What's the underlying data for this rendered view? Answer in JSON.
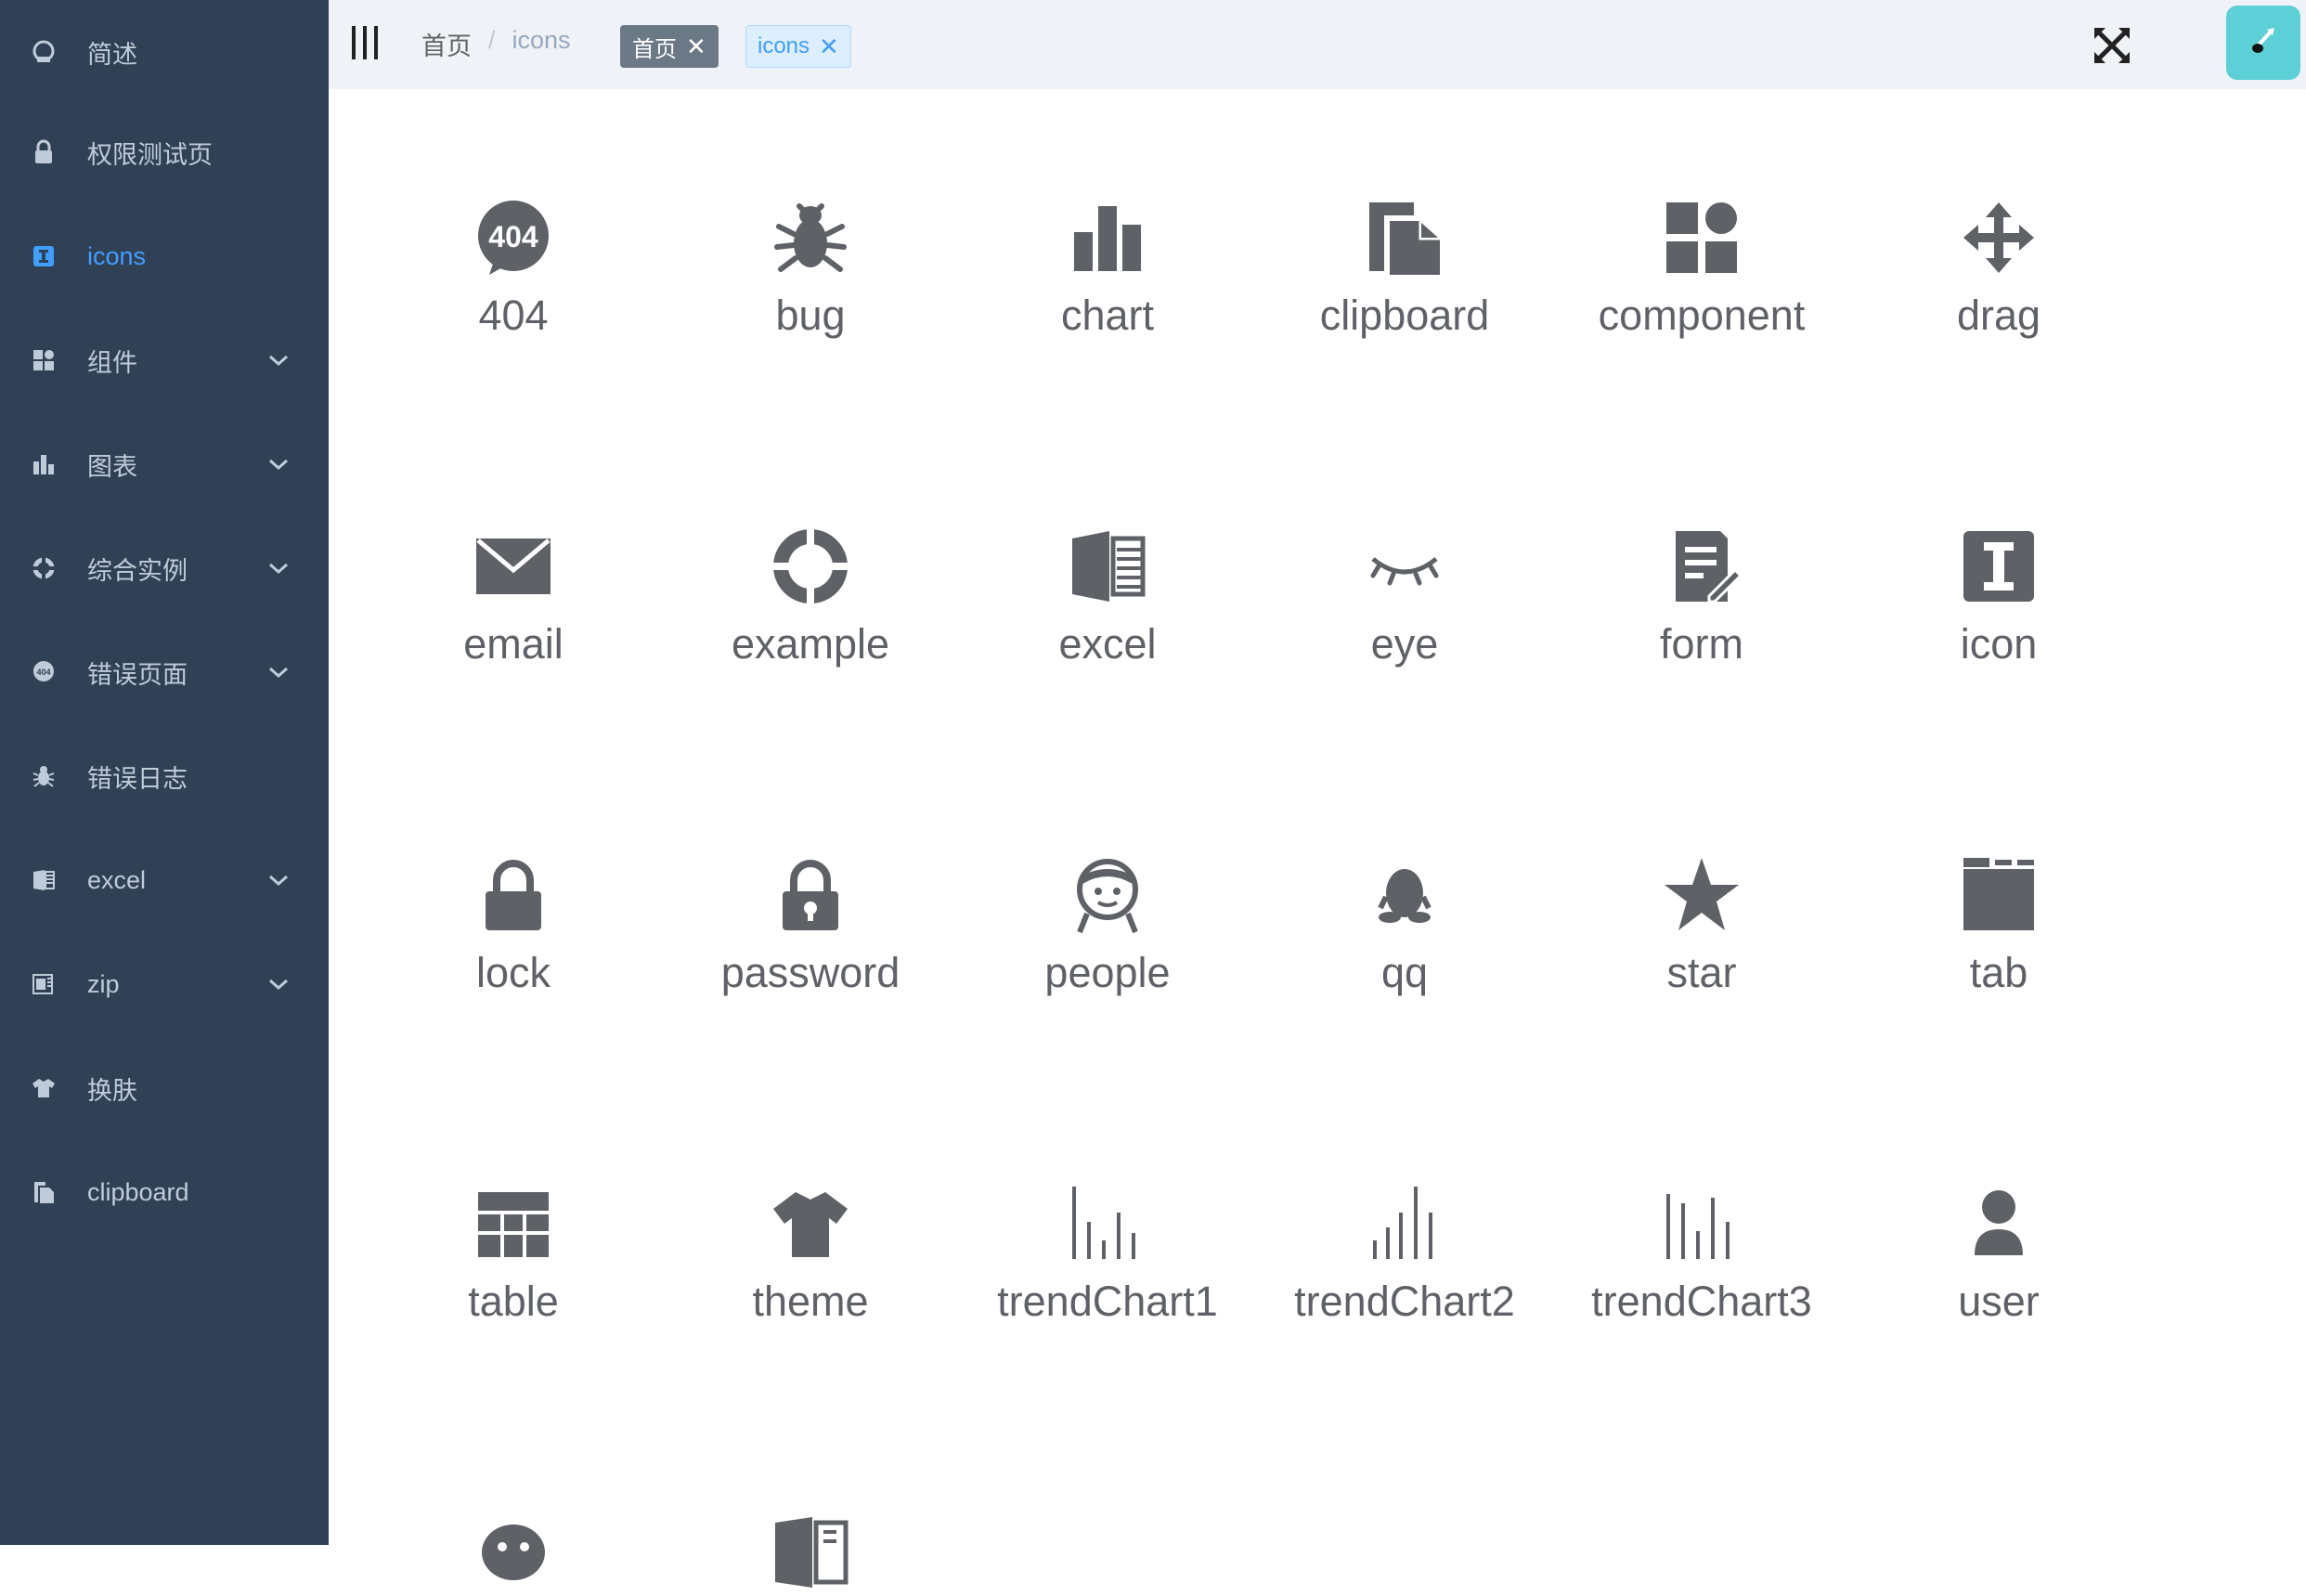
{
  "colors": {
    "sidebar_bg": "#304156",
    "sidebar_text": "#bfcbd9",
    "active": "#409eff",
    "navbar_bg": "#eff2f6",
    "icon": "#5e6166",
    "avatar_bg": "#5dcfd6"
  },
  "sidebar": {
    "items": [
      {
        "label": "简述",
        "icon": "dashboard-icon"
      },
      {
        "label": "权限测试页",
        "icon": "lock-icon"
      },
      {
        "label": "icons",
        "icon": "icon-icon",
        "active": true
      },
      {
        "label": "组件",
        "icon": "component-icon",
        "expandable": true
      },
      {
        "label": "图表",
        "icon": "chart-icon",
        "expandable": true
      },
      {
        "label": "综合实例",
        "icon": "example-icon",
        "expandable": true
      },
      {
        "label": "错误页面",
        "icon": "404-icon",
        "expandable": true
      },
      {
        "label": "错误日志",
        "icon": "bug-icon"
      },
      {
        "label": "excel",
        "icon": "excel-icon",
        "expandable": true
      },
      {
        "label": "zip",
        "icon": "zip-icon",
        "expandable": true
      },
      {
        "label": "换肤",
        "icon": "theme-icon"
      },
      {
        "label": "clipboard",
        "icon": "clipboard-icon"
      }
    ]
  },
  "navbar": {
    "breadcrumb": {
      "home": "首页",
      "separator": "/",
      "current": "icons"
    },
    "tags": [
      {
        "label": "首页",
        "close": "✕"
      },
      {
        "label": "icons",
        "close": "✕"
      }
    ]
  },
  "icons": [
    {
      "label": "404"
    },
    {
      "label": "bug"
    },
    {
      "label": "chart"
    },
    {
      "label": "clipboard"
    },
    {
      "label": "component"
    },
    {
      "label": "drag"
    },
    {
      "label": "email"
    },
    {
      "label": "example"
    },
    {
      "label": "excel"
    },
    {
      "label": "eye"
    },
    {
      "label": "form"
    },
    {
      "label": "icon"
    },
    {
      "label": "lock"
    },
    {
      "label": "password"
    },
    {
      "label": "people"
    },
    {
      "label": "qq"
    },
    {
      "label": "star"
    },
    {
      "label": "tab"
    },
    {
      "label": "table"
    },
    {
      "label": "theme"
    },
    {
      "label": "trendChart1"
    },
    {
      "label": "trendChart2"
    },
    {
      "label": "trendChart3"
    },
    {
      "label": "user"
    },
    {
      "label": ""
    },
    {
      "label": ""
    }
  ]
}
